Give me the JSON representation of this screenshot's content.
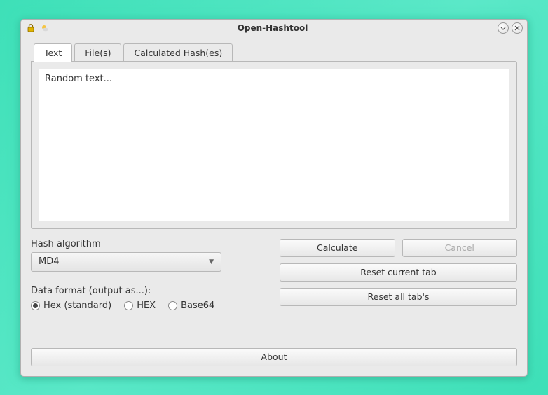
{
  "window": {
    "title": "Open-Hashtool"
  },
  "tabs": [
    {
      "label": "Text"
    },
    {
      "label": "File(s)"
    },
    {
      "label": "Calculated Hash(es)"
    }
  ],
  "textarea": {
    "value": "Random text..."
  },
  "hash": {
    "label": "Hash algorithm",
    "selected": "MD4"
  },
  "format": {
    "label": "Data format (output as...):",
    "options": [
      {
        "label": "Hex (standard)",
        "selected": true
      },
      {
        "label": "HEX",
        "selected": false
      },
      {
        "label": "Base64",
        "selected": false
      }
    ]
  },
  "buttons": {
    "calculate": "Calculate",
    "cancel": "Cancel",
    "reset_current": "Reset current tab",
    "reset_all": "Reset all tab's",
    "about": "About"
  }
}
